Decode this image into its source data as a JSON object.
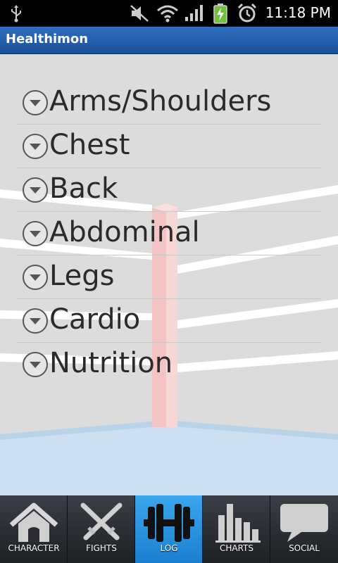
{
  "status_bar": {
    "time": "11:18 PM",
    "icons": [
      "usb-icon",
      "mute-icon",
      "wifi-icon",
      "signal-icon",
      "battery-charging-icon",
      "alarm-icon"
    ]
  },
  "app": {
    "title": "Healthimon"
  },
  "log_categories": [
    {
      "label": "Arms/Shoulders"
    },
    {
      "label": "Chest"
    },
    {
      "label": "Back"
    },
    {
      "label": "Abdominal"
    },
    {
      "label": "Legs"
    },
    {
      "label": "Cardio"
    },
    {
      "label": "Nutrition"
    }
  ],
  "bottom_nav": {
    "active": "LOG",
    "tabs": [
      {
        "label": "CHARACTER",
        "icon": "house-icon"
      },
      {
        "label": "FIGHTS",
        "icon": "crossed-swords-icon"
      },
      {
        "label": "LOG",
        "icon": "dumbbell-icon"
      },
      {
        "label": "CHARTS",
        "icon": "bar-chart-icon"
      },
      {
        "label": "SOCIAL",
        "icon": "speech-bubble-icon"
      }
    ]
  },
  "colors": {
    "titlebar": "#2e6fc0",
    "active_tab": "#2b93e0",
    "floor": "#cfe2f3",
    "post": "#f7c6c6"
  }
}
